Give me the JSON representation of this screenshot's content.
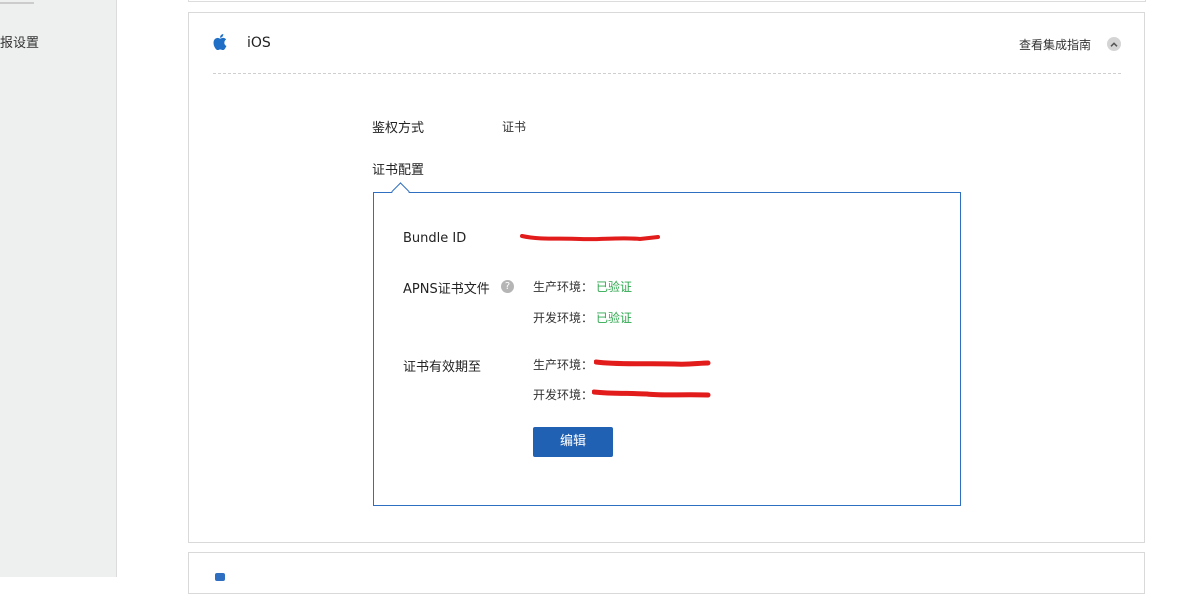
{
  "sidebar": {
    "items": [
      {
        "label": "报设置"
      }
    ]
  },
  "platform": {
    "icon": "apple-icon",
    "title": "iOS",
    "guide_link": "查看集成指南",
    "collapse_icon": "chevron-up-icon"
  },
  "auth": {
    "label": "鉴权方式",
    "value": "证书"
  },
  "cert_config": {
    "title": "证书配置",
    "bundle_id_label": "Bundle ID",
    "apns_label": "APNS证书文件",
    "help_icon": "?",
    "apns_production_label": "生产环境：",
    "apns_production_status": "已验证",
    "apns_development_label": "开发环境：",
    "apns_development_status": "已验证",
    "expiry_label": "证书有效期至",
    "expiry_production_label": "生产环境：",
    "expiry_development_label": "开发环境：",
    "edit_button": "编辑"
  },
  "colors": {
    "accent": "#2161b3",
    "border_accent": "#2f6fc2",
    "verified": "#2fa84f",
    "redaction": "#e21b1b"
  }
}
